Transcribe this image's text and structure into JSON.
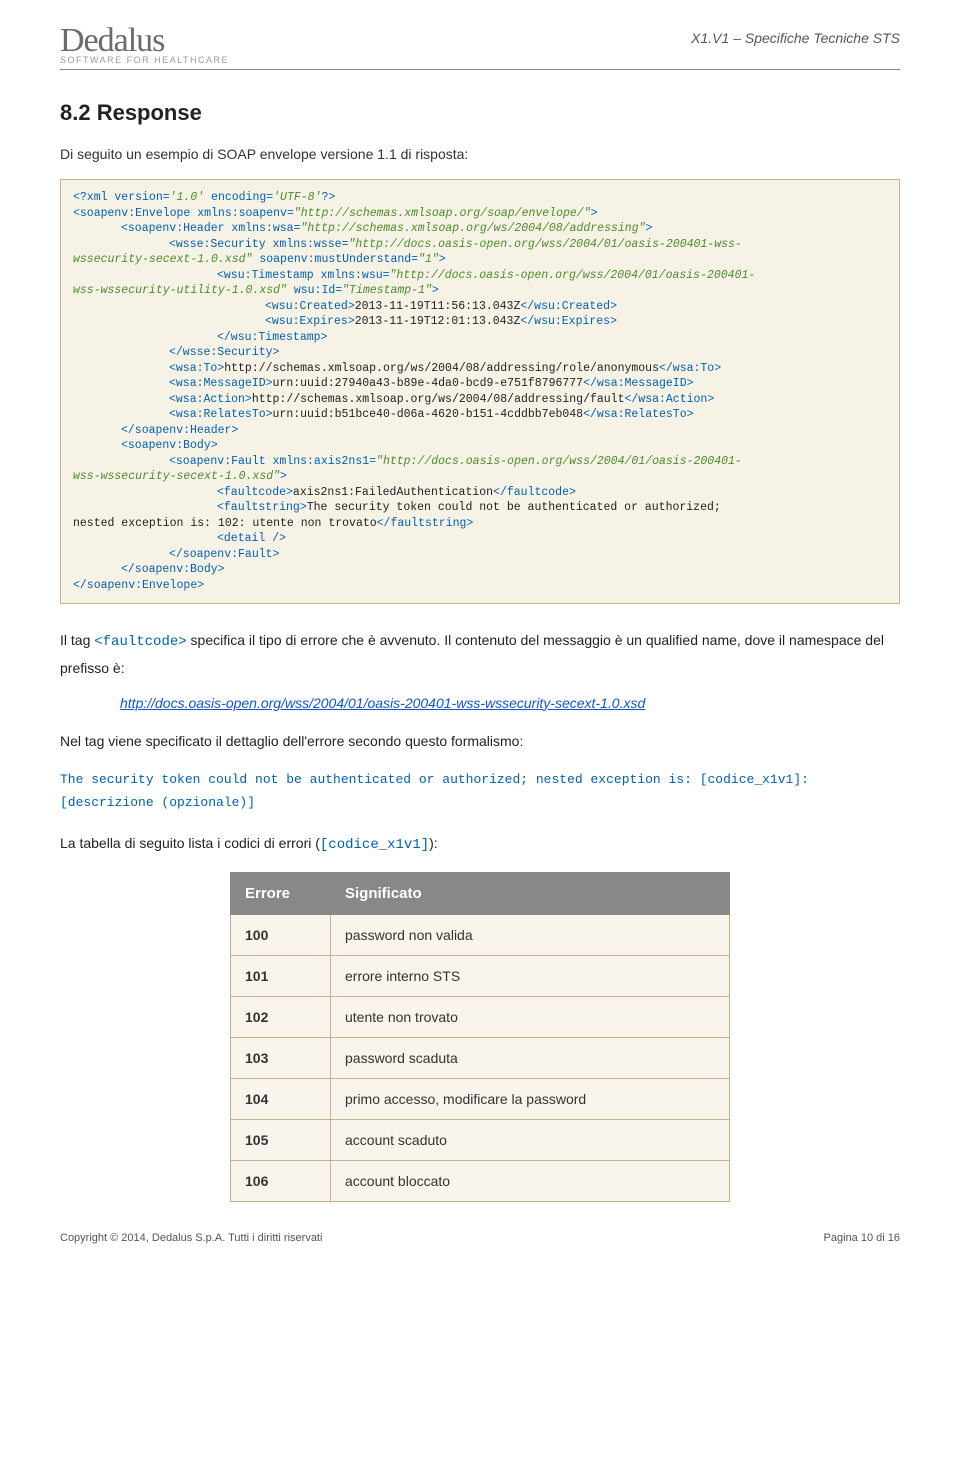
{
  "header": {
    "logo_name": "Dedalus",
    "logo_tagline": "SOFTWARE FOR HEALTHCARE",
    "doc_id": "X1.V1 – Specifiche Tecniche STS"
  },
  "section": {
    "number_title": "8.2 Response",
    "intro": "Di seguito un esempio di SOAP envelope versione 1.1 di risposta:"
  },
  "codebox": {
    "raw": "<?xml version='1.0' encoding='UTF-8'?>\n<soapenv:Envelope xmlns:soapenv=\"http://schemas.xmlsoap.org/soap/envelope/\">\n    <soapenv:Header xmlns:wsa=\"http://schemas.xmlsoap.org/ws/2004/08/addressing\">\n        <wsse:Security xmlns:wsse=\"http://docs.oasis-open.org/wss/2004/01/oasis-200401-wss-wssecurity-secext-1.0.xsd\" soapenv:mustUnderstand=\"1\">\n            <wsu:Timestamp xmlns:wsu=\"http://docs.oasis-open.org/wss/2004/01/oasis-200401-wss-wssecurity-utility-1.0.xsd\" wsu:Id=\"Timestamp-1\">\n                <wsu:Created>2013-11-19T11:56:13.043Z</wsu:Created>\n                <wsu:Expires>2013-11-19T12:01:13.043Z</wsu:Expires>\n            </wsu:Timestamp>\n        </wsse:Security>\n        <wsa:To>http://schemas.xmlsoap.org/ws/2004/08/addressing/role/anonymous</wsa:To>\n        <wsa:MessageID>urn:uuid:27940a43-b89e-4da0-bcd9-e751f8796777</wsa:MessageID>\n        <wsa:Action>http://schemas.xmlsoap.org/ws/2004/08/addressing/fault</wsa:Action>\n        <wsa:RelatesTo>urn:uuid:b51bce40-d06a-4620-b151-4cddbb7eb048</wsa:RelatesTo>\n    </soapenv:Header>\n    <soapenv:Body>\n        <soapenv:Fault xmlns:axis2ns1=\"http://docs.oasis-open.org/wss/2004/01/oasis-200401-wss-wssecurity-secext-1.0.xsd\">\n            <faultcode>axis2ns1:FailedAuthentication</faultcode>\n            <faultstring>The security token could not be authenticated or authorized; nested exception is: 102: utente non trovato</faultstring>\n            <detail />\n        </soapenv:Fault>\n    </soapenv:Body>\n</soapenv:Envelope>"
  },
  "body_text": {
    "para1_a": "Il tag ",
    "para1_code": "<faultcode>",
    "para1_b": " specifica il tipo di errore che è avvenuto. Il contenuto del messaggio è un qualified name, dove il namespace del prefisso è:",
    "link": "http://docs.oasis-open.org/wss/2004/01/oasis-200401-wss-wssecurity-secext-1.0.xsd",
    "para2": "Nel tag viene specificato il dettaglio dell'errore secondo questo formalismo:",
    "monoline": "The security token could not be authenticated or authorized; nested exception is: [codice_x1v1]: [descrizione (opzionale)]",
    "para3_a": "La tabella di seguito lista i codici di errori (",
    "para3_code": "[codice_x1v1]",
    "para3_b": "):"
  },
  "table": {
    "head": {
      "c1": "Errore",
      "c2": "Significato"
    },
    "rows": [
      {
        "code": "100",
        "desc": "password non valida"
      },
      {
        "code": "101",
        "desc": "errore interno STS"
      },
      {
        "code": "102",
        "desc": "utente non trovato"
      },
      {
        "code": "103",
        "desc": "password scaduta"
      },
      {
        "code": "104",
        "desc": "primo accesso, modificare la password"
      },
      {
        "code": "105",
        "desc": "account scaduto"
      },
      {
        "code": "106",
        "desc": "account bloccato"
      }
    ]
  },
  "footer": {
    "copyright": "Copyright © 2014, Dedalus S.p.A. Tutti i diritti riservati",
    "page": "Pagina 10 di 16"
  }
}
